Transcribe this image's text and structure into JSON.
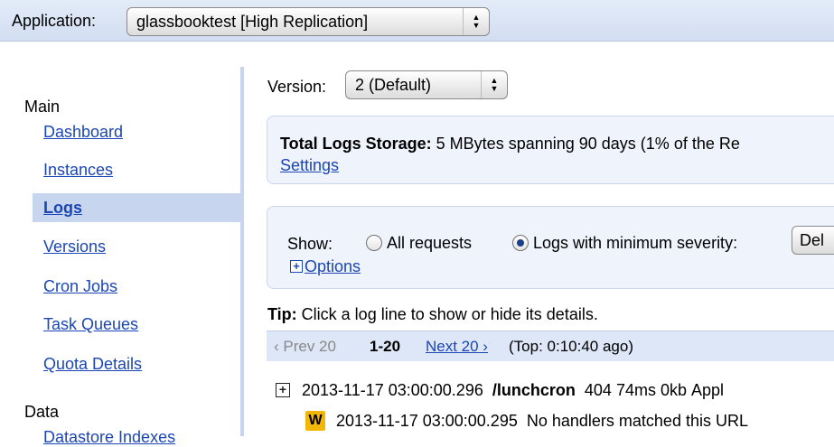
{
  "appbar": {
    "label": "Application:",
    "selected_app": "glassbooktest [High Replication]"
  },
  "sidebar": {
    "main_heading": "Main",
    "items": [
      {
        "label": "Dashboard"
      },
      {
        "label": "Instances"
      },
      {
        "label": "Logs",
        "active": true
      },
      {
        "label": "Versions"
      },
      {
        "label": "Cron Jobs"
      },
      {
        "label": "Task Queues"
      },
      {
        "label": "Quota Details"
      }
    ],
    "data_heading": "Data",
    "data_item_partial": "Datastore Indexes"
  },
  "version": {
    "label": "Version:",
    "selected": "2 (Default)"
  },
  "storage": {
    "label": "Total Logs Storage:",
    "text": " 5 MBytes spanning 90 days (1% of the Re",
    "settings_link": "Settings"
  },
  "filter": {
    "show_label": "Show:",
    "option_all": "All requests",
    "option_severity": "Logs with minimum severity:",
    "severity_value": "Del",
    "options_link": "Options"
  },
  "tip": {
    "label": "Tip:",
    "text": " Click a log line to show or hide its details."
  },
  "pager": {
    "prev": "‹ Prev 20",
    "range": "1-20",
    "next": "Next 20 ›",
    "top": "(Top: 0:10:40 ago)"
  },
  "logs": [
    {
      "timestamp": "2013-11-17 03:00:00.296",
      "path": "/lunchcron",
      "status": "404",
      "latency": "74ms",
      "size": "0kb",
      "trailing": "Appl"
    },
    {
      "badge": "W",
      "timestamp": "2013-11-17 03:00:00.295",
      "message": "No handlers matched this URL"
    }
  ],
  "colors": {
    "link": "#1b46b4",
    "active_nav_bg": "#c8d5ee",
    "panel_bg": "#eef3fc",
    "warning_badge": "#f2b705"
  }
}
